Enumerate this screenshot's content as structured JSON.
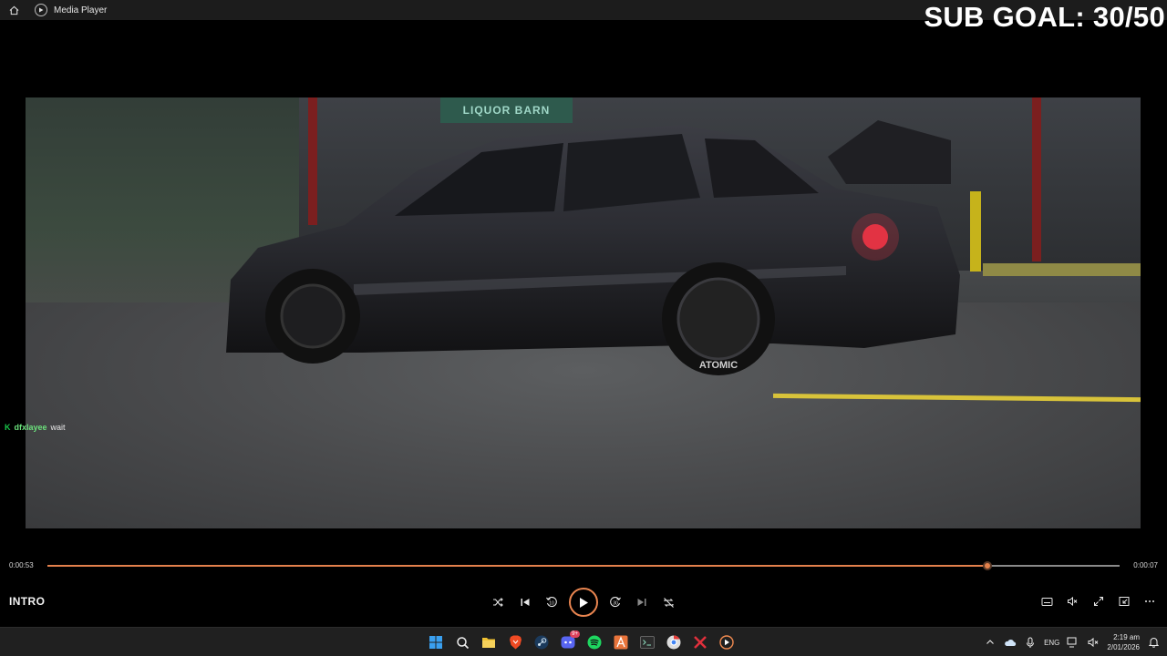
{
  "window": {
    "title": "Media Player"
  },
  "overlay": {
    "sub_goal": "SUB GOAL: 30/50"
  },
  "video": {
    "sign_text": "LIQUOR BARN",
    "tire_text": "ATOMIC"
  },
  "chat": {
    "badge": "K",
    "user": "dfxlayee",
    "message": "wait"
  },
  "player": {
    "elapsed": "0:00:53",
    "remaining": "0:00:07",
    "progress_fraction": 0.877,
    "title": "INTRO",
    "accent_color": "#e3814c"
  },
  "controls": {
    "center": [
      "shuffle-icon",
      "previous-icon",
      "rewind-10-icon",
      "play-icon",
      "forward-30-icon",
      "next-icon",
      "repeat-off-icon"
    ],
    "right": [
      "captions-icon",
      "volume-muted-icon",
      "fullscreen-icon",
      "mini-player-icon",
      "more-icon"
    ]
  },
  "taskbar": {
    "apps": [
      "windows-start-icon",
      "search-icon",
      "file-explorer-icon",
      "brave-icon",
      "steam-icon",
      "discord-icon",
      "spotify-icon",
      "app-icon",
      "terminal-icon",
      "chrome-icon",
      "app-x-icon",
      "media-player-icon"
    ],
    "discord_badge": "9+",
    "language": "ENG",
    "time": "2:19 am",
    "date": "2/01/2026"
  }
}
